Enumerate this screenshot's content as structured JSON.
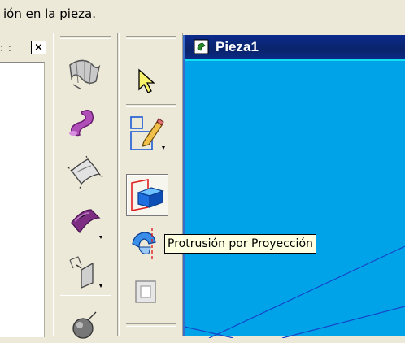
{
  "status_text": "ión en la pieza.",
  "left_panel": {
    "close_label": "×"
  },
  "toolbar_1": {
    "buttons": [
      {
        "name": "surface-sweep",
        "icon": "surface-sweep-icon"
      },
      {
        "name": "purple-hook",
        "icon": "hook-solid-icon"
      },
      {
        "name": "bounded-surface",
        "icon": "bounded-surface-icon"
      },
      {
        "name": "extruded-surface",
        "icon": "extruded-surface-icon"
      },
      {
        "name": "trim-surface",
        "icon": "trim-surface-icon"
      },
      {
        "name": "sphere",
        "icon": "sphere-icon"
      }
    ]
  },
  "toolbar_2": {
    "buttons": [
      {
        "name": "select",
        "icon": "arrow-cursor-icon"
      },
      {
        "name": "sketch",
        "icon": "sketch-pencil-icon"
      },
      {
        "name": "protrusion",
        "icon": "protrusion-icon",
        "pressed": true
      },
      {
        "name": "projection-protrusion",
        "icon": "revolve-cut-icon"
      },
      {
        "name": "thin-wall",
        "icon": "thin-wall-icon"
      }
    ]
  },
  "document": {
    "title": "Pieza1"
  },
  "tooltip": {
    "text": "Protrusión por Proyección"
  },
  "colors": {
    "viewport": "#00a2e8",
    "titlebar": "#0a246a",
    "tooltip_bg": "#ffffe1",
    "face": "#ece9d8"
  }
}
